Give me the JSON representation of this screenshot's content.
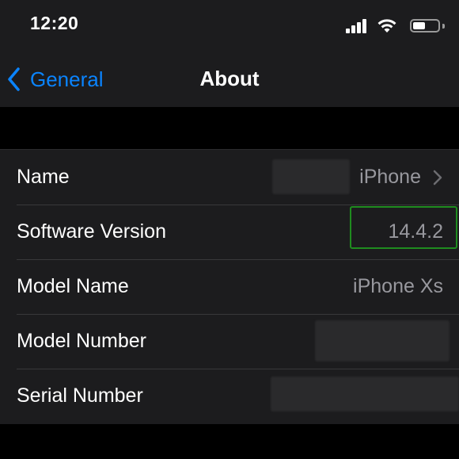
{
  "status_bar": {
    "time": "12:20"
  },
  "nav": {
    "back_label": "General",
    "title": "About"
  },
  "rows": [
    {
      "label": "Name",
      "value": "iPhone",
      "disclosure": true
    },
    {
      "label": "Software Version",
      "value": "14.4.2",
      "highlighted": true
    },
    {
      "label": "Model Name",
      "value": "iPhone Xs"
    },
    {
      "label": "Model Number",
      "value": ""
    },
    {
      "label": "Serial Number",
      "value": ""
    }
  ],
  "colors": {
    "accent": "#0a84ff",
    "background": "#000000",
    "cell": "#1c1c1e",
    "secondary_text": "#98989e",
    "highlight_border": "#1f8c1f"
  }
}
